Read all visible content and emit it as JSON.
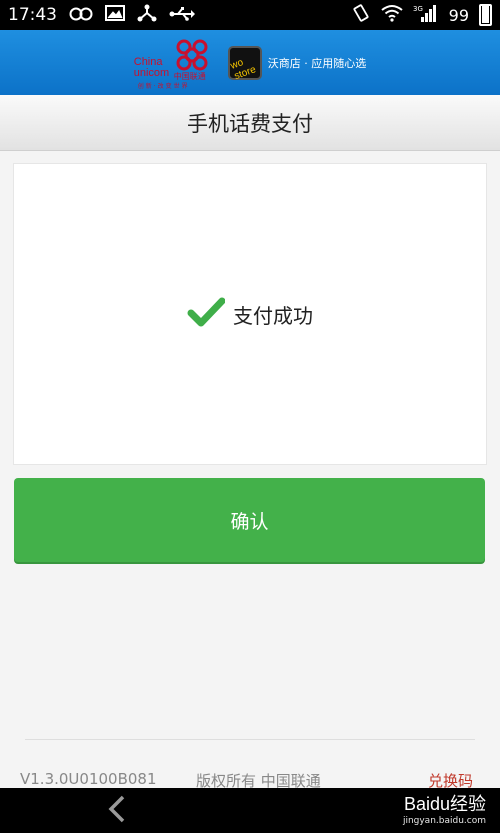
{
  "status_bar": {
    "time": "17:43",
    "battery_level": "99",
    "network": "3G"
  },
  "banner": {
    "unicom_name_line1": "China",
    "unicom_name_line2": "unicom",
    "unicom_cn": "中国联通",
    "slogan": "创新·改变世界",
    "store_text": "沃商店 · 应用随心选",
    "store_logo": "wo store"
  },
  "header": {
    "title": "手机话费支付"
  },
  "result": {
    "message": "支付成功",
    "status": "success",
    "check_color": "#3fae49"
  },
  "actions": {
    "confirm_label": "确认",
    "confirm_color": "#43b14a"
  },
  "footer": {
    "version": "V1.3.0U0100B081",
    "copyright": "版权所有 中国联通",
    "redeem_code": "兑换码"
  },
  "navigation": {
    "back": "back"
  },
  "watermark": {
    "brand": "Baidu经验",
    "url": "jingyan.baidu.com"
  }
}
